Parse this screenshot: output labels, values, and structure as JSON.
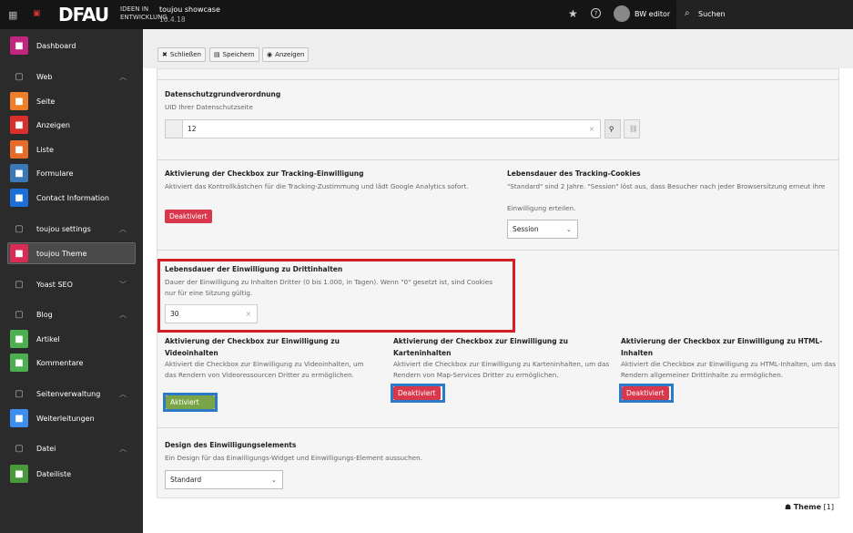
{
  "topbar": {
    "logo": "DFAU",
    "logo_tag": "IDEEN IN ENTWICKLUNG",
    "site": "toujou showcase",
    "version": "10.4.18",
    "user": "BW editor",
    "search": "Suchen"
  },
  "sidebar": {
    "items": [
      {
        "label": "Dashboard",
        "icon": "dashboard-icon",
        "color": "#c2257f"
      },
      {
        "label": "Web",
        "icon": "page-icon",
        "group": true,
        "chev": "^"
      },
      {
        "label": "Seite",
        "icon": "page-icon",
        "color": "#f07e26"
      },
      {
        "label": "Anzeigen",
        "icon": "eye-icon",
        "color": "#d9302c"
      },
      {
        "label": "Liste",
        "icon": "list-icon",
        "color": "#e46b2a"
      },
      {
        "label": "Formulare",
        "icon": "form-icon",
        "color": "#3b78b8"
      },
      {
        "label": "Contact Information",
        "icon": "contact-icon",
        "color": "#1c6fd8"
      },
      {
        "label": "toujou settings",
        "icon": "gear-icon",
        "group": true,
        "chev": "^"
      },
      {
        "label": "toujou Theme",
        "icon": "fingerprint-icon",
        "color": "#d92b55",
        "active": true
      },
      {
        "label": "Yoast SEO",
        "icon": "yoast-icon",
        "group": true,
        "chev": "v"
      },
      {
        "label": "Blog",
        "icon": "blog-icon",
        "group": true,
        "chev": "^"
      },
      {
        "label": "Artikel",
        "icon": "article-icon",
        "color": "#4caf50"
      },
      {
        "label": "Kommentare",
        "icon": "comment-icon",
        "color": "#4caf50"
      },
      {
        "label": "Seitenverwaltung",
        "icon": "globe-icon",
        "group": true,
        "chev": "^"
      },
      {
        "label": "Weiterleitungen",
        "icon": "redirect-icon",
        "color": "#3d8ef0"
      },
      {
        "label": "Datei",
        "icon": "image-icon",
        "group": true,
        "chev": "^"
      },
      {
        "label": "Dateiliste",
        "icon": "cloud-icon",
        "color": "#4a9a3c"
      }
    ]
  },
  "toolbar": {
    "close": "Schließen",
    "save": "Speichern",
    "view": "Anzeigen"
  },
  "form": {
    "privacy": {
      "label": "Datenschutzgrundverordnung",
      "desc": "UID Ihrer Datenschutzseite",
      "value": "12"
    },
    "tracking": {
      "label": "Aktivierung der Checkbox zur Tracking-Einwilligung",
      "desc": "Aktiviert das Kontrollkästchen für die Tracking-Zustimmung und lädt Google Analytics sofort.",
      "state": "Deaktiviert"
    },
    "cookie": {
      "label": "Lebensdauer des Tracking-Cookies",
      "desc1": "\"Standard\" sind 2 Jahre. \"Session\" löst aus, dass Besucher nach jeder Browsersitzung erneut ihre",
      "desc2": "Einwilligung erteilen.",
      "value": "Session"
    },
    "lifetime": {
      "label": "Lebensdauer der Einwilligung zu Drittinhalten",
      "desc": "Dauer der Einwilligung zu Inhalten Dritter (0 bis 1.000, in Tagen). Wenn \"0\" gesetzt ist, sind Cookies nur für eine Sitzung gültig.",
      "value": "30"
    },
    "video": {
      "label": "Aktivierung der Checkbox zur Einwilligung zu Videoinhalten",
      "desc": "Aktiviert die Checkbox zur Einwilligung zu Videoinhalten, um das Rendern von Videoressourcen Dritter zu ermöglichen.",
      "state": "Aktiviert"
    },
    "map": {
      "label": "Aktivierung der Checkbox zur Einwilligung zu Karteninhalten",
      "desc": "Aktiviert die Checkbox zur Einwilligung zu Karteninhalten, um das Rendern von Map-Services Dritter zu ermöglichen.",
      "state": "Deaktiviert"
    },
    "html": {
      "label": "Aktivierung der Checkbox zur Einwilligung zu HTML-Inhalten",
      "desc": "Aktiviert die Checkbox zur Einwilligung zu HTML-Inhalten, um das Rendern allgemeiner Drittinhalte zu ermöglichen.",
      "state": "Deaktiviert"
    },
    "design": {
      "label": "Design des Einwilligungselements",
      "desc": "Ein Design für das Einwilligungs-Widget und Einwilligungs-Element aussuchen.",
      "value": "Standard"
    }
  },
  "footer": {
    "record": "Theme",
    "count": "[1]"
  }
}
